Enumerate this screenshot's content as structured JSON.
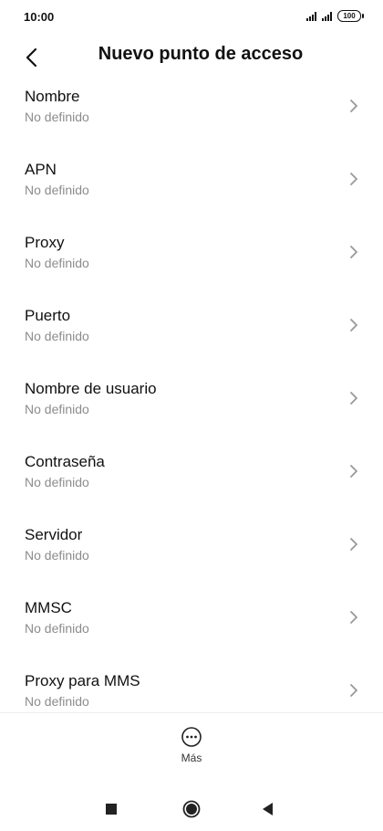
{
  "status_bar": {
    "time": "10:00",
    "battery": "100"
  },
  "header": {
    "title": "Nuevo punto de acceso"
  },
  "fields": [
    {
      "title": "Nombre",
      "value": "No definido"
    },
    {
      "title": "APN",
      "value": "No definido"
    },
    {
      "title": "Proxy",
      "value": "No definido"
    },
    {
      "title": "Puerto",
      "value": "No definido"
    },
    {
      "title": "Nombre de usuario",
      "value": "No definido"
    },
    {
      "title": "Contraseña",
      "value": "No definido"
    },
    {
      "title": "Servidor",
      "value": "No definido"
    },
    {
      "title": "MMSC",
      "value": "No definido"
    },
    {
      "title": "Proxy para MMS",
      "value": "No definido"
    }
  ],
  "bottom": {
    "more_label": "Más"
  }
}
